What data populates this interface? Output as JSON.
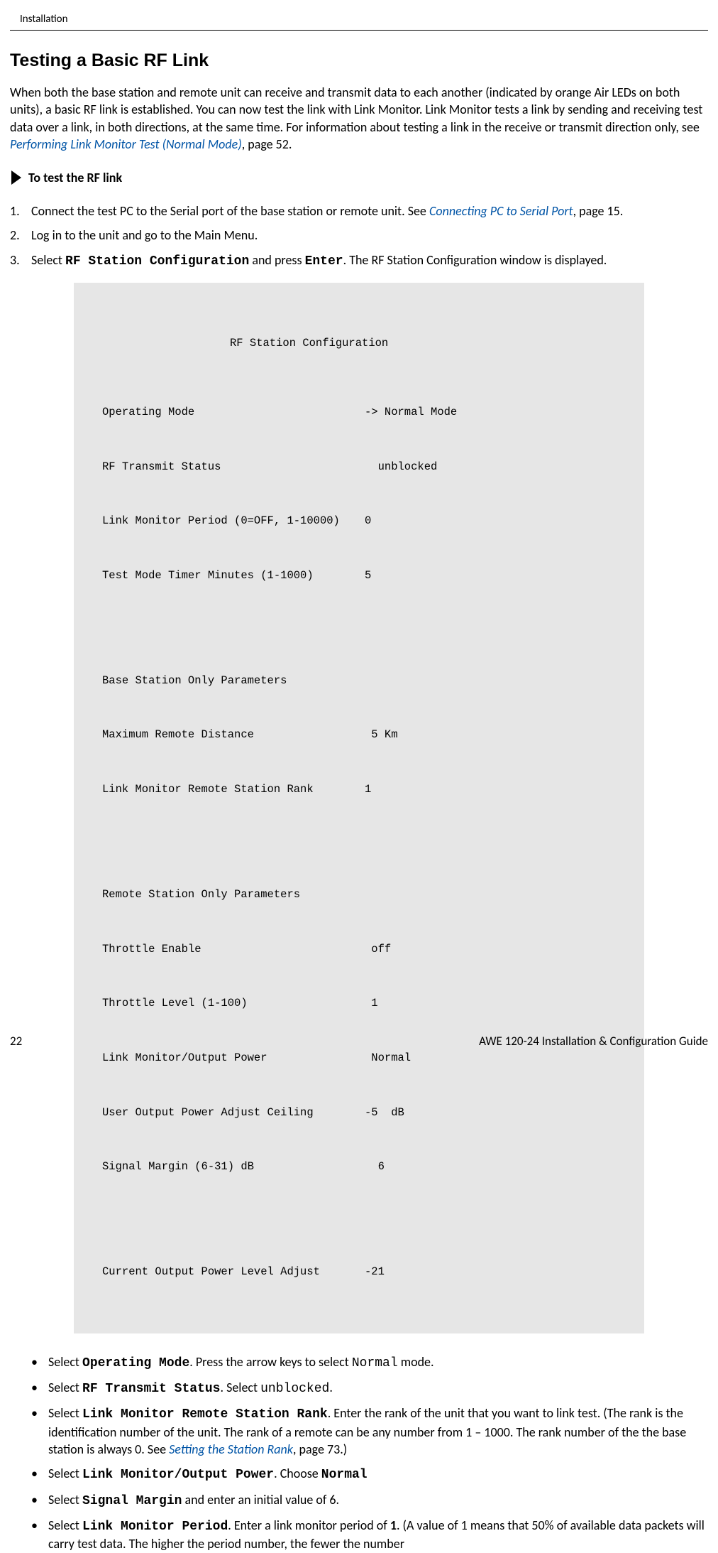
{
  "header": {
    "section": "Installation"
  },
  "main": {
    "heading": "Testing a Basic RF Link",
    "intro_part1": "When both the base station and remote unit can receive and transmit data to each another (indicated by orange Air LEDs on both units), a basic RF link is established. You can now test the link with Link Monitor. Link Monitor tests a link by sending and receiving test data over a link, in both directions, at the same time. For information about testing a link in the receive or transmit direction only, see ",
    "intro_link": "Performing Link Monitor Test (Normal Mode)",
    "intro_part2": ", page 52.",
    "procedure_heading": "To test the RF link",
    "steps": {
      "s1": {
        "num": "1.",
        "text_a": "Connect the test PC to the Serial port of the base station or remote unit. See ",
        "link": "Connecting PC to Serial Port",
        "text_b": ", page 15."
      },
      "s2": {
        "num": "2.",
        "text": "Log in to the unit and go to the Main Menu."
      },
      "s3": {
        "num": "3.",
        "text_a": "Select ",
        "code_a": "RF Station Configuration",
        "text_b": " and press ",
        "code_b": "Enter",
        "text_c": ". The RF Station Configuration window is displayed."
      }
    },
    "terminal": {
      "title": "RF Station Configuration",
      "rows": {
        "r1": {
          "label": "Operating Mode",
          "val": "-> Normal Mode"
        },
        "r2": {
          "label": "RF Transmit Status",
          "val": "  unblocked"
        },
        "r3": {
          "label": "Link Monitor Period (0=OFF, 1-10000)",
          "val": "0"
        },
        "r4": {
          "label": "Test Mode Timer Minutes (1-1000)",
          "val": "5"
        },
        "r5": {
          "label": "Base Station Only Parameters",
          "val": ""
        },
        "r6": {
          "label": "Maximum Remote Distance",
          "val": " 5 Km"
        },
        "r7": {
          "label": "Link Monitor Remote Station Rank",
          "val": "1"
        },
        "r8": {
          "label": "Remote Station Only Parameters",
          "val": ""
        },
        "r9": {
          "label": "Throttle Enable",
          "val": " off"
        },
        "r10": {
          "label": "Throttle Level (1-100)",
          "val": " 1"
        },
        "r11": {
          "label": "Link Monitor/Output Power",
          "val": " Normal"
        },
        "r12": {
          "label": "User Output Power Adjust Ceiling",
          "val": "-5  dB"
        },
        "r13": {
          "label": "Signal Margin (6-31) dB",
          "val": "  6"
        },
        "r14": {
          "label": "Current Output Power Level Adjust",
          "val": "-21"
        }
      }
    },
    "bullets": {
      "b1": {
        "text_a": "Select ",
        "code_a": "Operating Mode",
        "text_b": ". Press the arrow keys to select ",
        "mono_a": "Normal",
        "text_c": " mode."
      },
      "b2": {
        "text_a": "Select ",
        "code_a": "RF Transmit Status",
        "text_b": ". Select ",
        "mono_a": "unblocked",
        "text_c": "."
      },
      "b3": {
        "text_a": "Select ",
        "code_a": "Link Monitor Remote Station Rank",
        "text_b": ". Enter the rank of the unit that you want to link test. (The rank is the identification number of the unit. The rank of a remote can be any number from 1 – 1000. The rank number of the the base station is always 0. See ",
        "link": "Setting the Station Rank",
        "text_c": ", page 73.)"
      },
      "b4": {
        "text_a": " Select ",
        "code_a": "Link Monitor/Output Power",
        "text_b": ". Choose ",
        "code_b": "Normal"
      },
      "b5": {
        "text_a": " Select ",
        "code_a": "Signal Margin",
        "text_b": " and enter an initial value of 6."
      },
      "b6": {
        "text_a": " Select ",
        "code_a": "Link Monitor Period",
        "text_b": ". Enter a link monitor period of ",
        "bold_a": "1",
        "text_c": ". (A value of 1 means that 50% of available data packets will carry test data. The higher the period number, the fewer the number"
      }
    }
  },
  "footer": {
    "page": "22",
    "title": "AWE 120-24 Installation & Configuration Guide"
  }
}
